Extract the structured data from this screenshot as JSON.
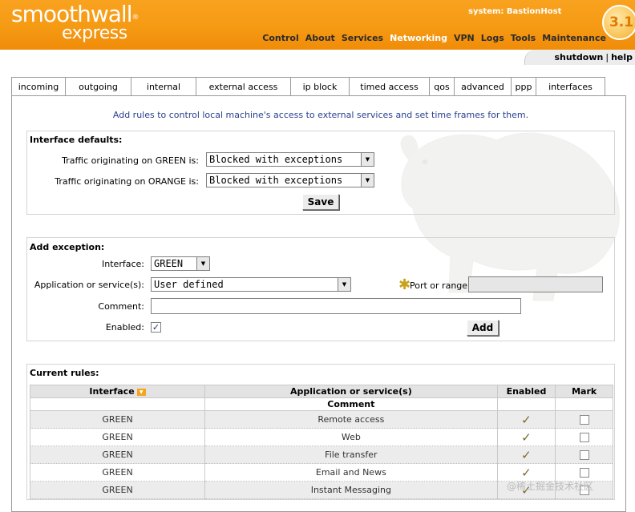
{
  "brand": {
    "line1": "smoothwall",
    "reg": "®",
    "line2": "express",
    "version": "3.1"
  },
  "system_label": "system: BastionHost",
  "main_nav": [
    "Control",
    "About",
    "Services",
    "Networking",
    "VPN",
    "Logs",
    "Tools",
    "Maintenance"
  ],
  "util_links": {
    "shutdown": "shutdown",
    "sep": "|",
    "help": "help"
  },
  "tabs": [
    "incoming",
    "outgoing",
    "internal",
    "external access",
    "ip block",
    "timed access",
    "qos",
    "advanced",
    "ppp",
    "interfaces"
  ],
  "intro": "Add rules to control local machine's access to external services and set time frames for them.",
  "interface_defaults": {
    "title": "Interface defaults:",
    "green_label": "Traffic originating on GREEN is:",
    "green_value": "Blocked with exceptions",
    "orange_label": "Traffic originating on ORANGE is:",
    "orange_value": "Blocked with exceptions",
    "save_label": "Save"
  },
  "add_exception": {
    "title": "Add exception:",
    "interface_label": "Interface:",
    "interface_value": "GREEN",
    "service_label": "Application or service(s):",
    "service_value": "User defined",
    "port_label": "Port or range:",
    "port_value": "",
    "comment_label": "Comment:",
    "comment_value": "",
    "enabled_label": "Enabled:",
    "enabled_mark": "✓",
    "add_label": "Add"
  },
  "current_rules": {
    "title": "Current rules:",
    "headers": {
      "interface": "Interface",
      "service": "Application or service(s)",
      "comment": "Comment",
      "enabled": "Enabled",
      "mark": "Mark"
    },
    "rows": [
      {
        "interface": "GREEN",
        "service": "Remote access",
        "enabled": "✓"
      },
      {
        "interface": "GREEN",
        "service": "Web",
        "enabled": "✓"
      },
      {
        "interface": "GREEN",
        "service": "File transfer",
        "enabled": "✓"
      },
      {
        "interface": "GREEN",
        "service": "Email and News",
        "enabled": "✓"
      },
      {
        "interface": "GREEN",
        "service": "Instant Messaging",
        "enabled": "✓"
      }
    ]
  },
  "watermark": "@稀土掘金技术社区",
  "colors": {
    "header_orange": "#f59a13",
    "intro_blue": "#273f8e"
  }
}
